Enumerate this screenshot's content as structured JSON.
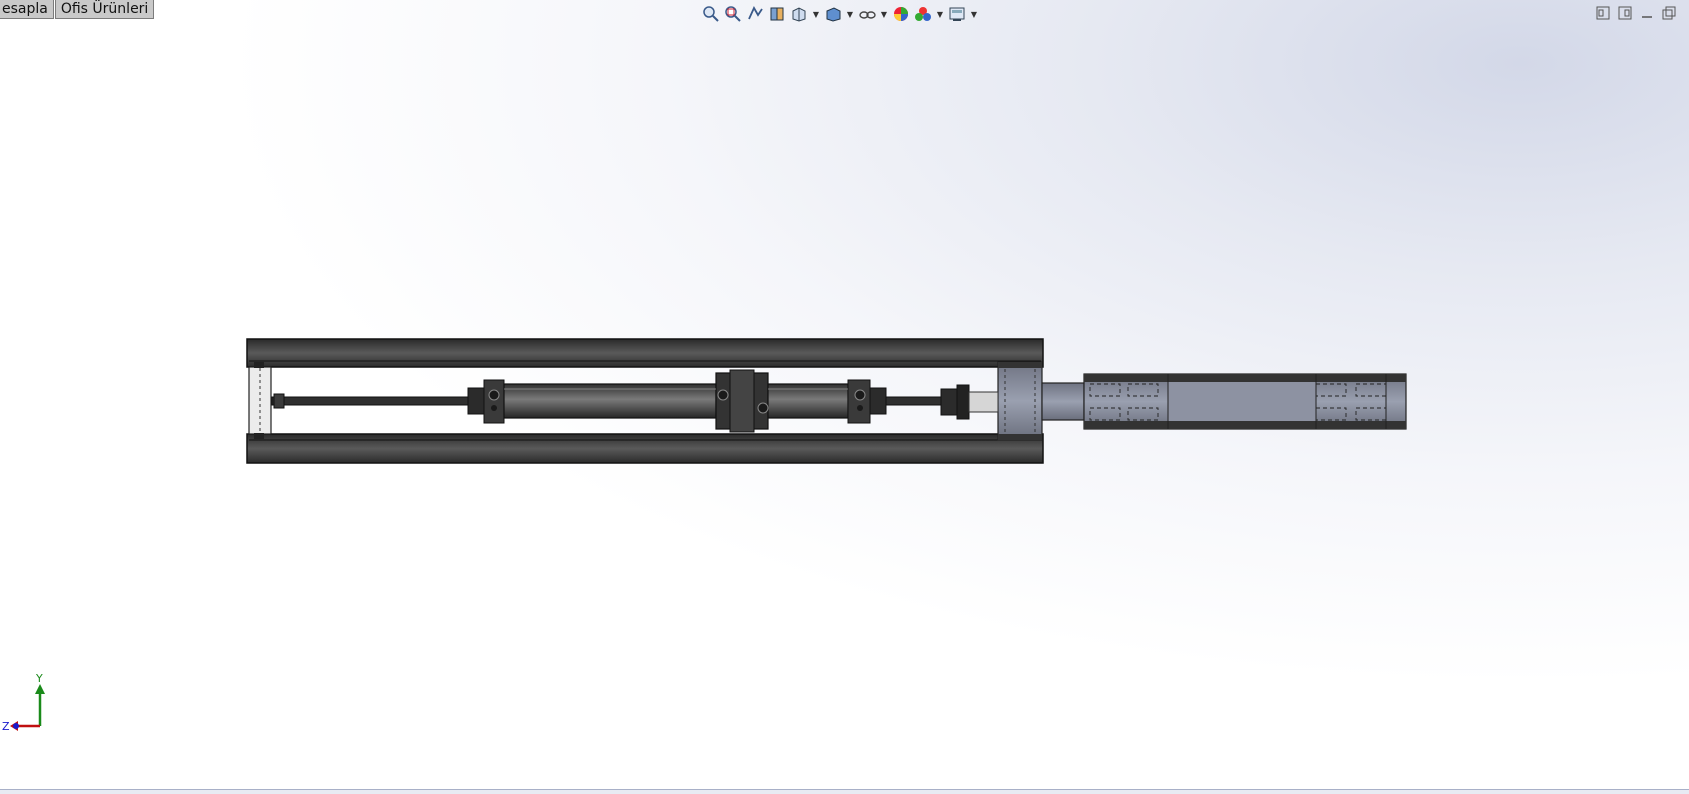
{
  "tabs": [
    {
      "label": "esapla"
    },
    {
      "label": "Ofis Ürünleri"
    }
  ],
  "heads_up_toolbar": {
    "icons": [
      "zoom-to-fit-icon",
      "zoom-to-area-icon",
      "previous-view-icon",
      "section-view-icon",
      "view-orientation-icon",
      "display-style-icon",
      "hide-show-items-icon",
      "edit-appearance-icon",
      "apply-scene-icon",
      "view-settings-icon"
    ]
  },
  "window_controls": [
    "tile-horizontal-icon",
    "tile-vertical-icon",
    "minimize-icon",
    "restore-icon"
  ],
  "triad": {
    "y_label": "Y",
    "z_label": "Z"
  },
  "colors": {
    "accent_axis_y": "#1a8a1a",
    "accent_axis_x": "#c01010",
    "accent_axis_z": "#1a1acc",
    "model_dark": "#3a3a3a",
    "model_plate": "#8a8f9e"
  }
}
